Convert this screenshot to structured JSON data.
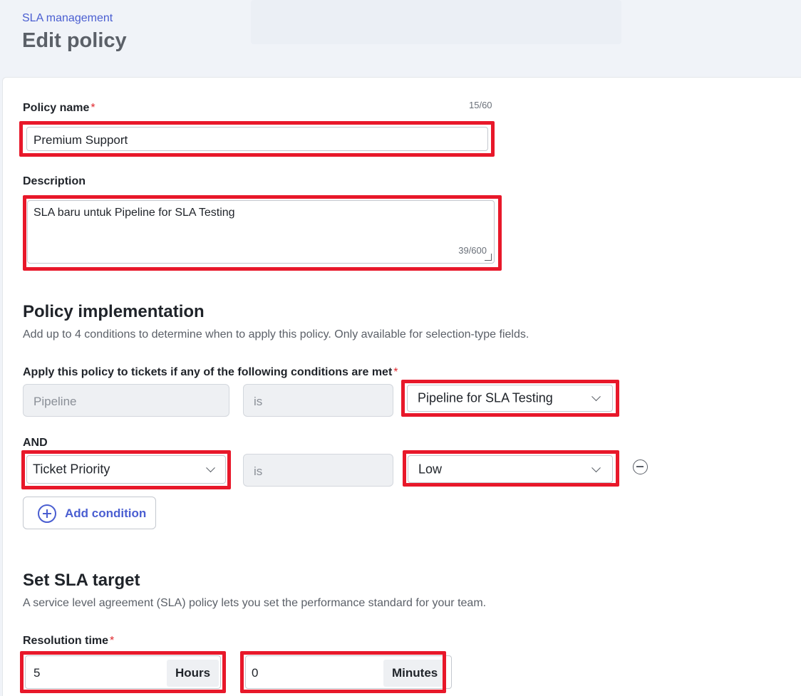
{
  "header": {
    "breadcrumb": "SLA management",
    "title": "Edit policy"
  },
  "policy_name": {
    "label": "Policy name",
    "required_mark": "*",
    "counter": "15/60",
    "value": "Premium Support"
  },
  "description": {
    "label": "Description",
    "value": "SLA baru untuk Pipeline for SLA Testing",
    "counter": "39/600"
  },
  "implementation": {
    "title": "Policy implementation",
    "hint": "Add up to 4 conditions to determine when to apply this policy. Only available for selection-type fields.",
    "conditions_label": "Apply this policy to tickets if any of the following conditions are met",
    "required_mark": "*",
    "condition1": {
      "field": "Pipeline",
      "operator": "is",
      "value": "Pipeline for SLA Testing"
    },
    "joiner": "AND",
    "condition2": {
      "field": "Ticket Priority",
      "operator": "is",
      "value": "Low"
    },
    "add_condition_label": "Add condition"
  },
  "sla_target": {
    "title": "Set SLA target",
    "hint": "A service level agreement (SLA) policy lets you set the performance standard for your team.",
    "resolution_label": "Resolution time",
    "required_mark": "*",
    "hours_value": "5",
    "hours_unit": "Hours",
    "minutes_value": "0",
    "minutes_unit": "Minutes"
  },
  "colors": {
    "accent": "#4a5ed1",
    "highlight": "#e8182a",
    "required": "#e0282e"
  }
}
